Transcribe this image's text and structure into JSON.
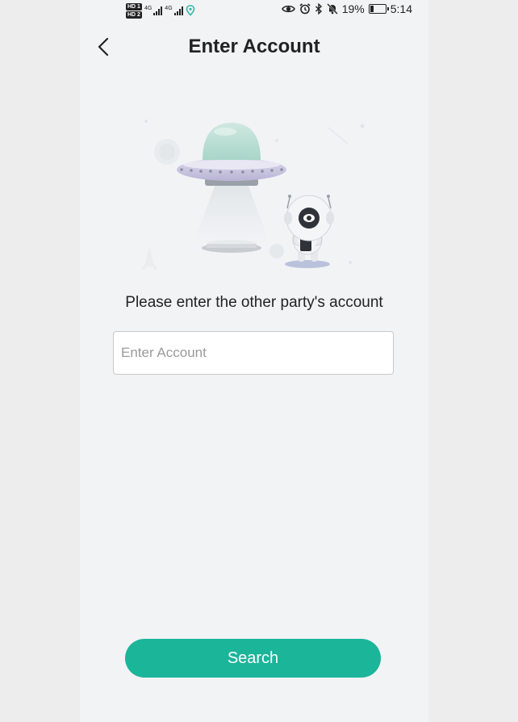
{
  "status_bar": {
    "hd1": "HD 1",
    "hd2": "HD 2",
    "network1": "4G",
    "network2": "4G",
    "battery": "19%",
    "time": "5:14",
    "icons": [
      "eye-icon",
      "alarm-icon",
      "bluetooth-icon",
      "mute-icon",
      "location-icon"
    ]
  },
  "header": {
    "title": "Enter Account",
    "back_icon": "chevron-left-icon"
  },
  "illustration": {
    "name": "ufo-robot-illustration"
  },
  "form": {
    "prompt": "Please enter the other party's account",
    "account_value": "",
    "account_placeholder": "Enter Account"
  },
  "actions": {
    "search_label": "Search"
  },
  "colors": {
    "accent": "#1bb59a",
    "background": "#f2f3f5",
    "text": "#222222",
    "placeholder": "#9a9a9a"
  }
}
